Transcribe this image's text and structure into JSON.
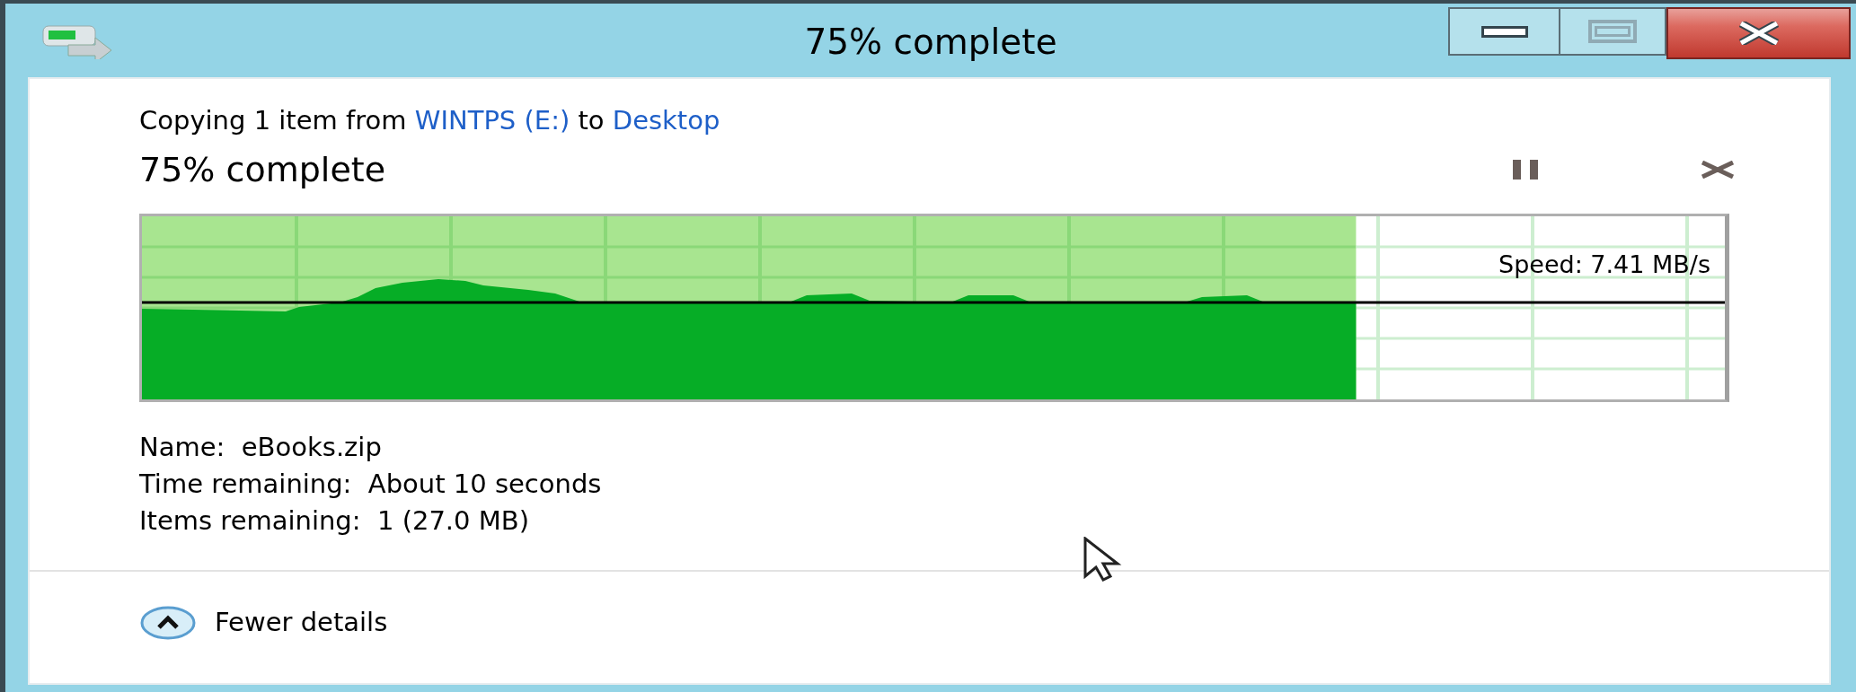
{
  "window": {
    "title": "75% complete"
  },
  "copy_line": [
    {
      "kind": "plain",
      "text": "Copying 1 item from"
    },
    {
      "kind": "link",
      "text": "WINTPS (E:)"
    },
    {
      "kind": "plain",
      "text": "to"
    },
    {
      "kind": "link",
      "text": "Desktop"
    }
  ],
  "status": "75% complete",
  "graph": {
    "level": 0.767,
    "speed": "Speed: 7.41 MB/s"
  },
  "details": [
    {
      "label": "Name:",
      "value": "eBooks.zip"
    },
    {
      "label": "Time remaining:",
      "value": "About 10 seconds"
    },
    {
      "label": "Items remaining:",
      "value": "1 (27.0 MB)"
    }
  ],
  "toggle": {
    "label": "Fewer details",
    "expanded": true
  }
}
